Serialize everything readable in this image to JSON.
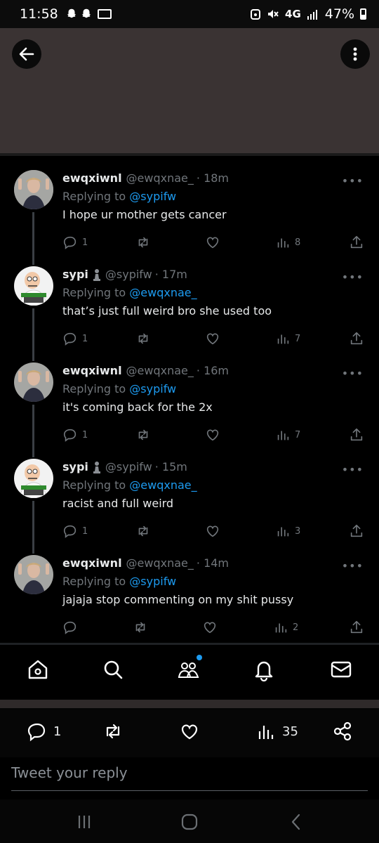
{
  "status_bar": {
    "time": "11:58",
    "network": "4G",
    "battery": "47%"
  },
  "header": {
    "back_icon": "arrow-left-icon",
    "more_icon": "more-vertical-icon"
  },
  "tweets": [
    {
      "name": "ewqxiwnl",
      "handle": "@ewqxnae_",
      "time": "· 18m",
      "reply_prefix": "Replying to",
      "reply_to": "@sypifw",
      "text": "I hope ur mother gets cancer",
      "replies": "1",
      "views": "8",
      "avatar": "person-photo"
    },
    {
      "name": "sypi",
      "handle": "@sypifw",
      "time": "· 17m",
      "reply_prefix": "Replying to",
      "reply_to": "@ewqxnae_",
      "text": "that’s just full weird bro she used too",
      "replies": "1",
      "views": "7",
      "avatar": "cartoon-character"
    },
    {
      "name": "ewqxiwnl",
      "handle": "@ewqxnae_",
      "time": "· 16m",
      "reply_prefix": "Replying to",
      "reply_to": "@sypifw",
      "text": "it's coming back for the 2x",
      "replies": "1",
      "views": "7",
      "avatar": "person-photo"
    },
    {
      "name": "sypi",
      "handle": "@sypifw",
      "time": "· 15m",
      "reply_prefix": "Replying to",
      "reply_to": "@ewqxnae_",
      "text": "racist and full weird",
      "replies": "1",
      "views": "3",
      "avatar": "cartoon-character"
    },
    {
      "name": "ewqxiwnl",
      "handle": "@ewqxnae_",
      "time": "· 14m",
      "reply_prefix": "Replying to",
      "reply_to": "@sypifw",
      "text": "jajaja stop commenting on my shit pussy",
      "replies": "",
      "views": "2",
      "avatar": "person-photo"
    }
  ],
  "tabbar": [
    "home-icon",
    "search-icon",
    "communities-icon",
    "notifications-icon",
    "messages-icon"
  ],
  "engagement": {
    "replies": "1",
    "views": "35"
  },
  "reply_box": {
    "placeholder": "Tweet your reply"
  },
  "colors": {
    "accent": "#1d9bf0",
    "muted": "#71767b",
    "text": "#e7e9ea",
    "header_bg": "#3a3333"
  }
}
